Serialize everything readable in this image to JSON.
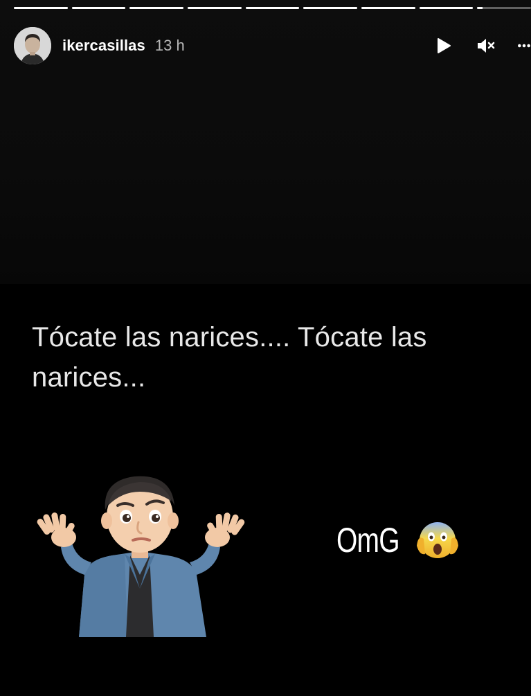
{
  "story": {
    "progress_segments": [
      1,
      1,
      1,
      1,
      1,
      1,
      1,
      1,
      0.1
    ],
    "user": {
      "username": "ikercasillas",
      "time_ago": "13 h"
    },
    "controls": {
      "play_icon": "play-icon",
      "mute_icon": "muted-speaker-icon",
      "more_icon": "more-options-icon"
    },
    "caption": "Tócate las narices.... Tócate las narices...",
    "sticker_text": "OmG",
    "emoji": "😱"
  }
}
